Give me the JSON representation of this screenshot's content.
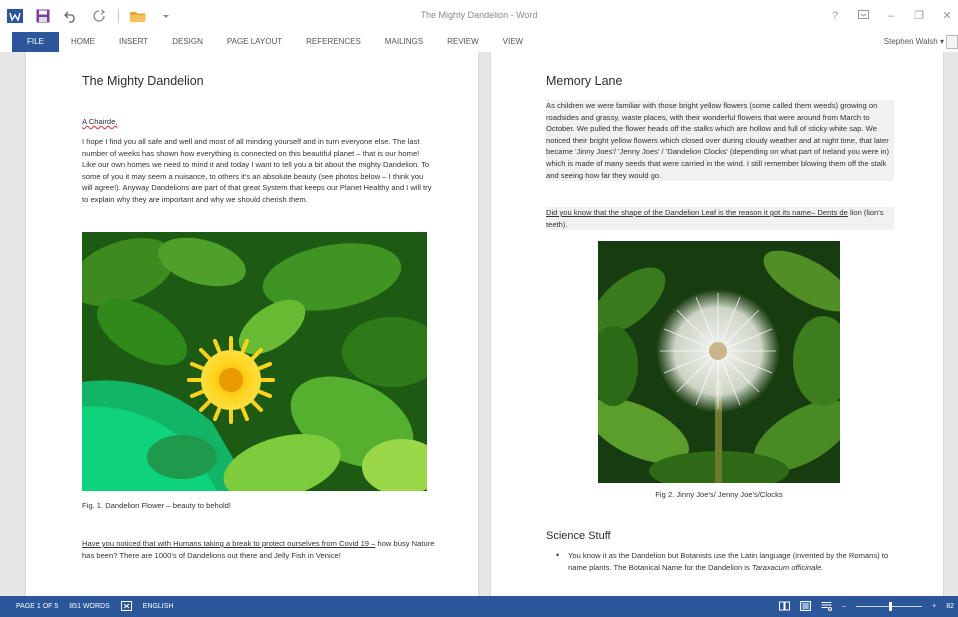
{
  "window": {
    "title": "The Mighty Dandelion - Word",
    "help_label": "?",
    "minimize_label": "–",
    "restore_label": "❐",
    "close_label": "✕"
  },
  "ribbon": {
    "file_label": "FILE",
    "tabs": [
      "HOME",
      "INSERT",
      "DESIGN",
      "PAGE LAYOUT",
      "REFERENCES",
      "MAILINGS",
      "REVIEW",
      "VIEW"
    ],
    "user_name": "Stephen Walsh"
  },
  "page_left": {
    "title": "The Mighty Dandelion",
    "greeting": "A Chairde,",
    "intro_paragraph": "I hope I find you all safe and well and most of all minding yourself and in turn everyone else. The last number of weeks has shown how everything is connected on this beautiful planet – that is our home! Like our own homes we need to mind it and today I want to tell you a bit about the mighty Dandelion. To some of you it may seem a nuisance, to others it's an absolute beauty (see photos below – I think you will agree!). Anyway Dandelions are part of that great System that keeps our Planet Healthy and I will try to explain why they are important and why we should cherish them.",
    "figure1_caption": "Fig. 1. Dandelion Flower – beauty to behold!",
    "covid_underlined": "Have you noticed that with Humans taking a break to protect ourselves from Covid 19 –",
    "covid_rest": "how busy Nature has been? There are 1000's of Dandelions out there and Jelly Fish in Venice!"
  },
  "page_right": {
    "title": "Memory Lane",
    "memory_paragraph": "As children we were familiar with those bright yellow flowers (some called them weeds) growing on roadsides and grassy, waste places, with their wonderful flowers that were around from March to October. We pulled the flower heads off the stalks which are hollow and full of sticky white sap. We noticed their bright yellow flowers which closed over during cloudy weather and at night time, that later became 'Jinny Joes'/ 'Jenny Joes' / 'Dandelion Clocks' (depending on what part of Ireland you were in) which is made of many seeds that were carried in the wind. I still remember blowing them off the stalk and seeing how far they would go.",
    "leaf_underlined": "Did you know that the shape of the Dandelion Leaf is the reason it got its name– Dents de",
    "leaf_rest": "lion (lion's teeth).",
    "figure2_caption": "Fig 2. Jinny Joe's/ Jenny Joe's/Clocks",
    "science_heading": "Science Stuff",
    "bullet_text": "You know it as the Dandelion but Botanists use the Latin language (invented by the Romans) to name plants. The Botanical Name for the Dandelion is",
    "bullet_latin": "Taraxacum officinale."
  },
  "statusbar": {
    "page_info": "PAGE 1 OF 5",
    "word_count": "851 WORDS",
    "language": "ENGLISH",
    "zoom_minus": "–",
    "zoom_plus": "+",
    "zoom_level": "82",
    "zoom_fraction": 0.52
  },
  "colors": {
    "accent": "#2b579a",
    "save_icon": "#7a3d9a",
    "open_icon": "#e8a33b"
  }
}
